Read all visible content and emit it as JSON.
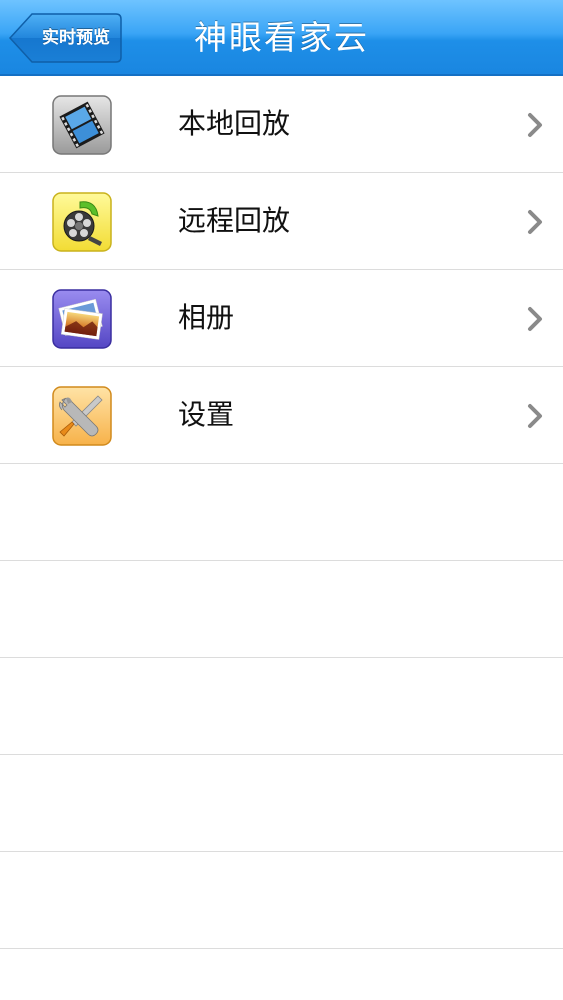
{
  "navbar": {
    "back_label": "实时预览",
    "title": "神眼看家云"
  },
  "menu": [
    {
      "label": "本地回放",
      "icon": "film-strip-icon"
    },
    {
      "label": "远程回放",
      "icon": "film-reel-icon"
    },
    {
      "label": "相册",
      "icon": "photo-album-icon"
    },
    {
      "label": "设置",
      "icon": "wrench-screwdriver-icon"
    }
  ],
  "colors": {
    "navbar_top": "#6ec3ff",
    "navbar_bottom": "#1a86e0",
    "separator": "#dcdcdc",
    "chevron": "#8a8a8a"
  }
}
